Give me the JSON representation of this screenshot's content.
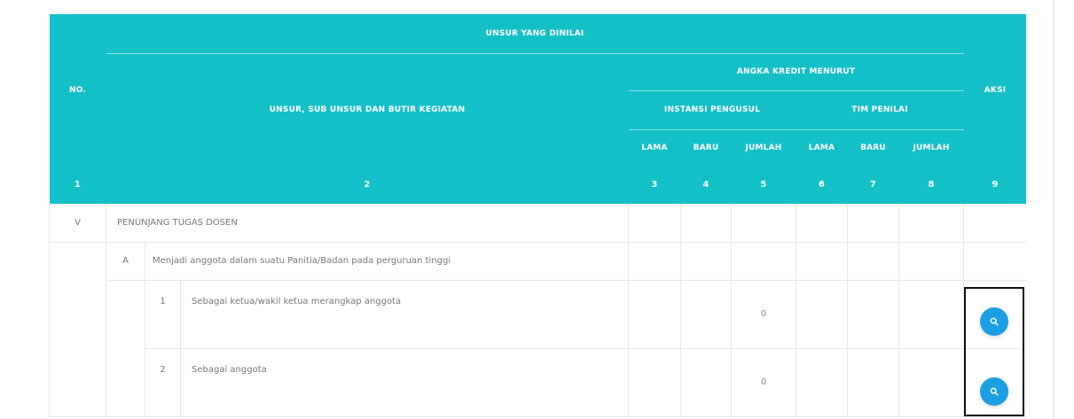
{
  "table": {
    "header": {
      "no": "NO.",
      "unsur_dinilai": "UNSUR YANG DINILAI",
      "unsur_sub": "UNSUR, SUB UNSUR DAN BUTIR KEGIATAN",
      "angka_kredit": "ANGKA KREDIT MENURUT",
      "instansi": "INSTANSI PENGUSUL",
      "tim": "TIM PENILAI",
      "aksi": "AKSI",
      "lama": "LAMA",
      "baru": "BARU",
      "jumlah": "JUMLAH"
    },
    "index_row": [
      "1",
      "2",
      "3",
      "4",
      "5",
      "6",
      "7",
      "8",
      "9"
    ],
    "rows": [
      {
        "no": "V",
        "text": "PENUNJANG TUGAS DOSEN"
      },
      {
        "no": "A",
        "text": "Menjadi anggota dalam suatu Panitia/Badan pada perguruan tinggi"
      },
      {
        "no": "1",
        "text": "Sebagai ketua/wakil ketua merangkap anggota",
        "jumlah": "0"
      },
      {
        "no": "2",
        "text": "Sebagai anggota",
        "jumlah": "0"
      }
    ]
  },
  "icons": {
    "action": "search-icon"
  },
  "colors": {
    "header": "#14c0c8",
    "button": "#1b9fe2"
  }
}
